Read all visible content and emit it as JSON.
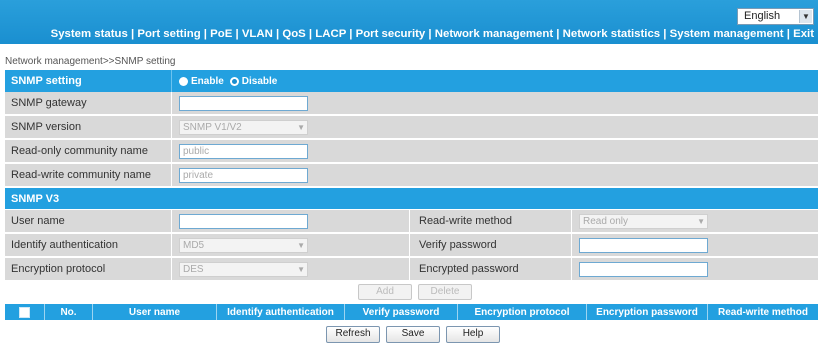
{
  "header": {
    "language": "English",
    "nav": "System status | Port setting | PoE | VLAN | QoS | LACP | Port security | Network management | Network statistics | System management | Exit"
  },
  "breadcrumb": "Network management>>SNMP setting",
  "snmp": {
    "title": "SNMP setting",
    "enable_label": "Enable",
    "disable_label": "Disable",
    "gateway_label": "SNMP gateway",
    "gateway_value": "",
    "version_label": "SNMP version",
    "version_value": "SNMP V1/V2",
    "ro_label": "Read-only community name",
    "ro_value": "public",
    "rw_label": "Read-write community name",
    "rw_value": "private"
  },
  "v3": {
    "title": "SNMP V3",
    "user_label": "User name",
    "user_value": "",
    "auth_label": "Identify authentication",
    "auth_value": "MD5",
    "enc_label": "Encryption protocol",
    "enc_value": "DES",
    "rwm_label": "Read-write method",
    "rwm_value": "Read only",
    "verify_label": "Verify password",
    "encpw_label": "Encrypted password",
    "add_label": "Add",
    "delete_label": "Delete"
  },
  "table": {
    "columns": [
      "No.",
      "User name",
      "Identify authentication",
      "Verify password",
      "Encryption protocol",
      "Encryption password",
      "Read-write method"
    ]
  },
  "footer": {
    "refresh": "Refresh",
    "save": "Save",
    "help": "Help"
  }
}
